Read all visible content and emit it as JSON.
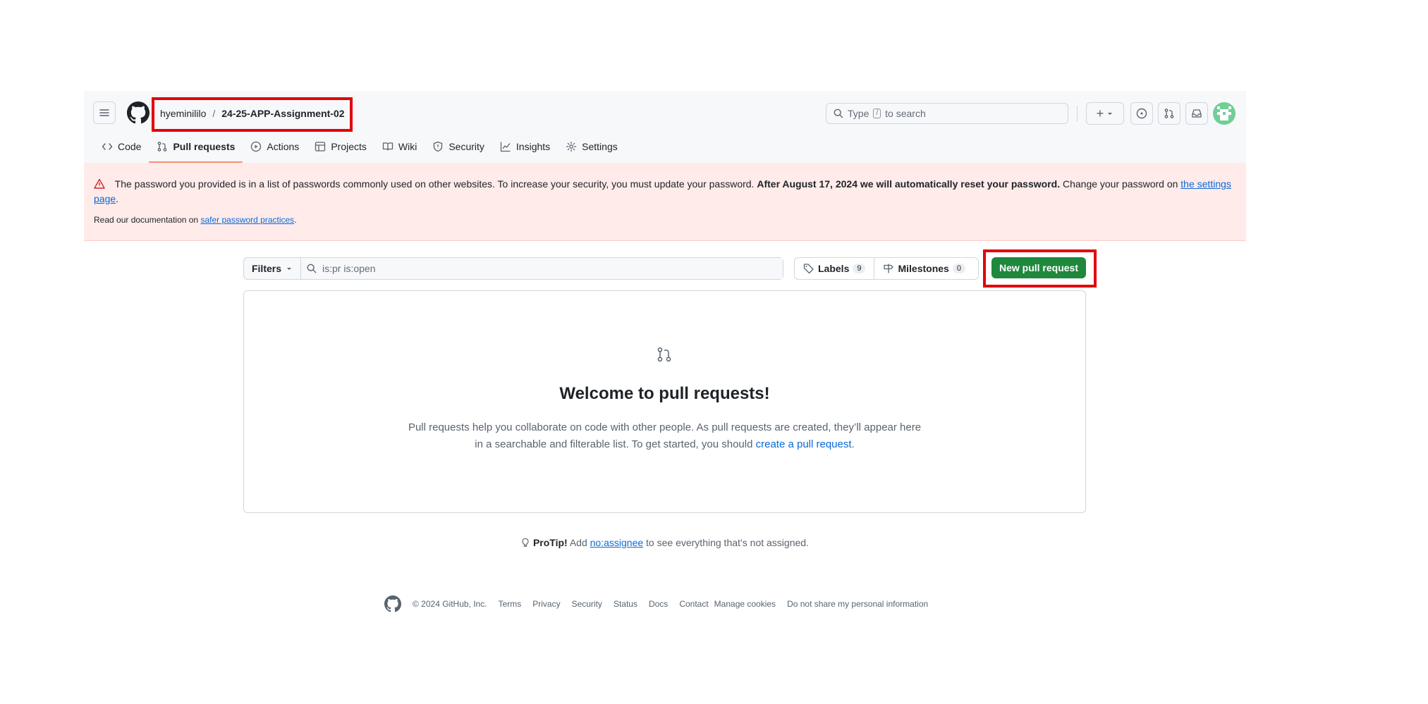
{
  "header": {
    "owner": "hyemini​lilo",
    "separator": "/",
    "repo": "24-25-APP-Assignment-02",
    "search_type": "Type",
    "search_key": "/",
    "search_rest": "to search",
    "plus_symbol": "+"
  },
  "tabs": [
    {
      "label": "Code",
      "icon": "code-icon"
    },
    {
      "label": "Pull requests",
      "icon": "pull-request-icon"
    },
    {
      "label": "Actions",
      "icon": "play-icon"
    },
    {
      "label": "Projects",
      "icon": "table-icon"
    },
    {
      "label": "Wiki",
      "icon": "book-icon"
    },
    {
      "label": "Security",
      "icon": "shield-icon"
    },
    {
      "label": "Insights",
      "icon": "graph-icon"
    },
    {
      "label": "Settings",
      "icon": "gear-icon"
    }
  ],
  "banner": {
    "text1": "The password you provided is in a list of passwords commonly used on other websites. To increase your security, you must update your password.",
    "bold": "After August 17, 2024 we will automatically reset your password.",
    "text2": "Change your password on",
    "link": "the settings page",
    "period": ".",
    "doc_prefix": "Read our documentation on",
    "doc_link": "safer password practices",
    "doc_suffix": "."
  },
  "subnav": {
    "filters_label": "Filters",
    "search_value": "is:pr is:open",
    "labels_label": "Labels",
    "labels_count": "9",
    "milestones_label": "Milestones",
    "milestones_count": "0",
    "new_pr_label": "New pull request"
  },
  "blankslate": {
    "title": "Welcome to pull requests!",
    "line1": "Pull requests help you collaborate on code with other people. As pull requests are created, they’ll appear here",
    "line2_prefix": "in a searchable and filterable list. To get started, you should",
    "link": "create a pull request",
    "line2_suffix": "."
  },
  "protip": {
    "bold": "ProTip!",
    "prefix": "Add",
    "link": "no:assignee",
    "suffix": "to see everything that’s not assigned."
  },
  "footer": {
    "copyright": "© 2024 GitHub, Inc.",
    "links": [
      "Terms",
      "Privacy",
      "Security",
      "Status",
      "Docs",
      "Contact",
      "Manage cookies",
      "Do not share my personal information"
    ]
  },
  "colors": {
    "accent": "#0969da",
    "primary_button": "#1f883d",
    "banner_bg": "#ffebe9",
    "annotation": "#e3000f"
  }
}
